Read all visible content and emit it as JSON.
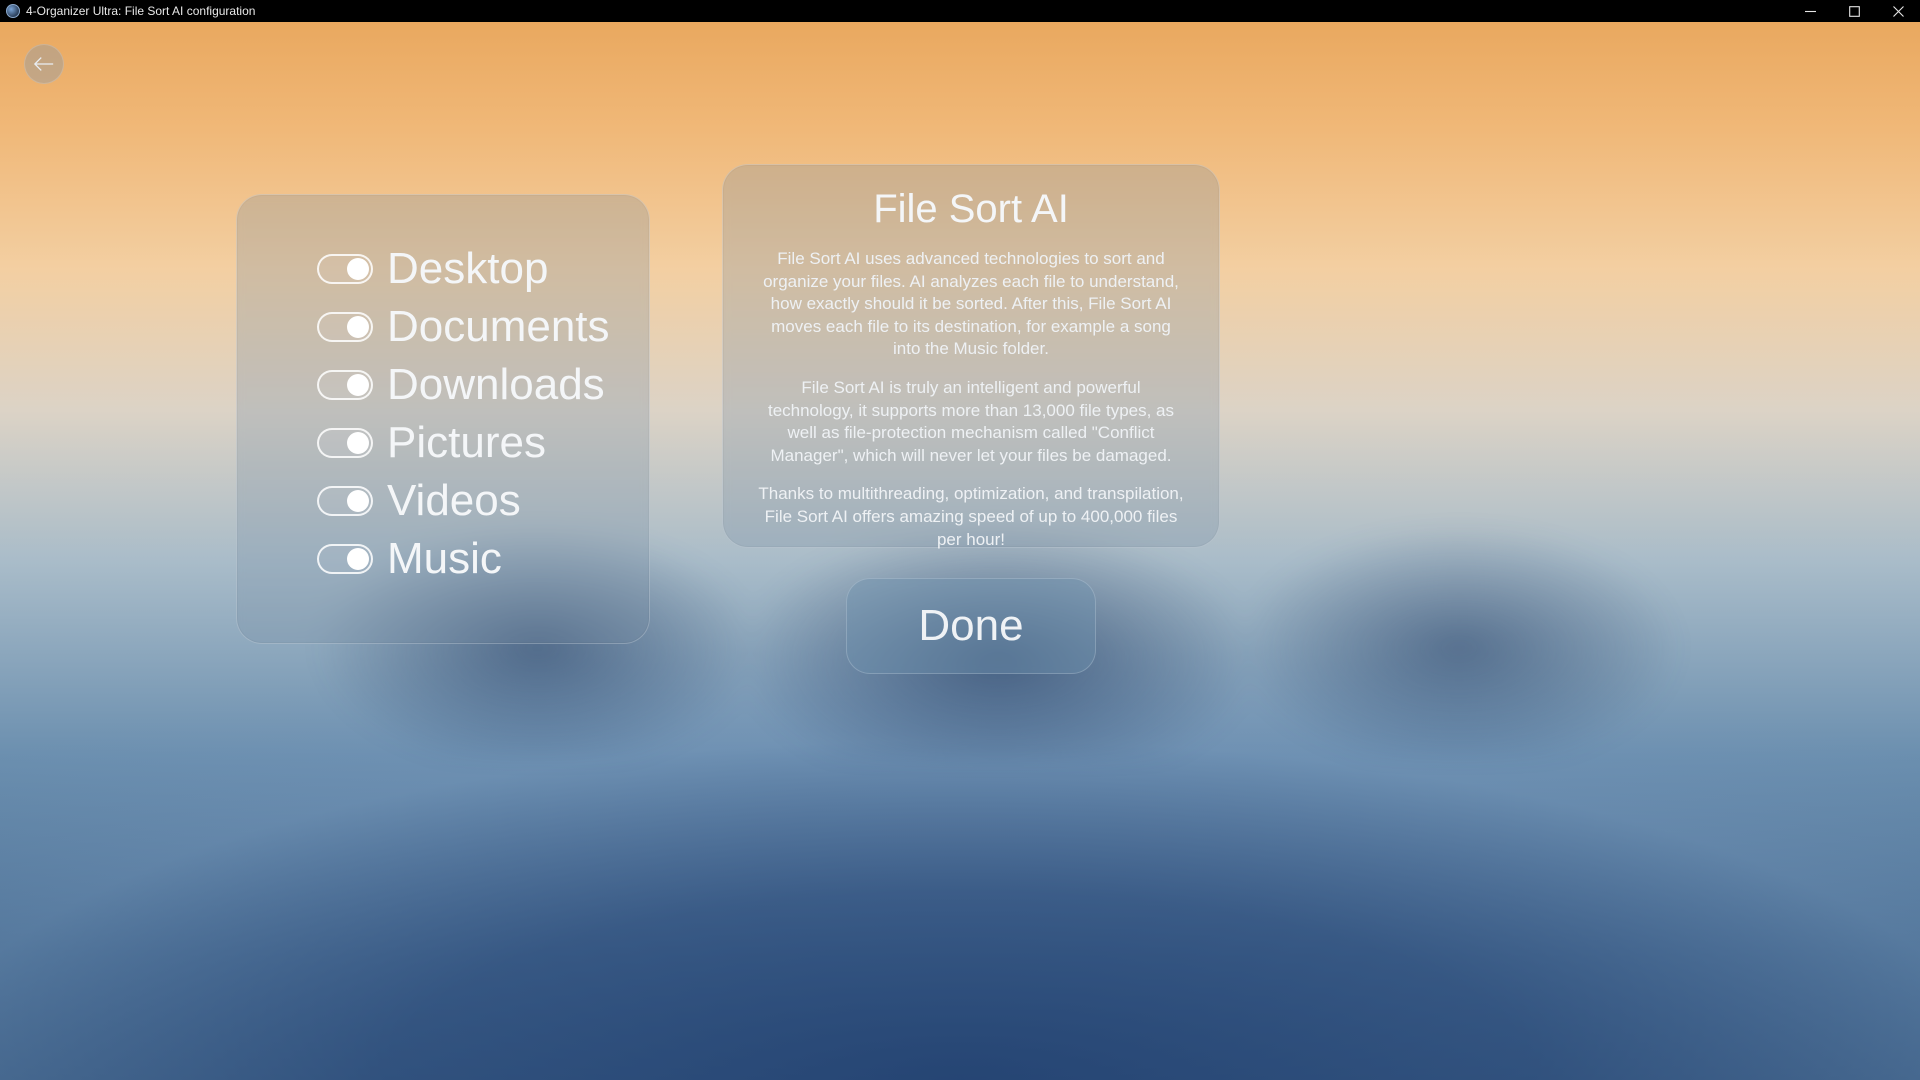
{
  "window": {
    "title": "4-Organizer Ultra: File Sort AI configuration"
  },
  "toggles": {
    "items": [
      {
        "label": "Desktop",
        "on": true
      },
      {
        "label": "Documents",
        "on": true
      },
      {
        "label": "Downloads",
        "on": true
      },
      {
        "label": "Pictures",
        "on": true
      },
      {
        "label": "Videos",
        "on": true
      },
      {
        "label": "Music",
        "on": true
      }
    ]
  },
  "info": {
    "title": "File Sort AI",
    "para1": "File Sort AI uses advanced technologies to sort and organize your files. AI analyzes each file to understand, how exactly should it be sorted. After this, File Sort AI moves each file to its destination, for example a song into the Music folder.",
    "para2": "File Sort AI is truly an intelligent and powerful technology, it supports more than 13,000 file types, as well as file-protection mechanism called \"Conflict Manager\", which will never let your files be damaged.",
    "para3": "Thanks to multithreading, optimization, and transpilation, File Sort AI offers amazing speed of up to 400,000 files per hour!"
  },
  "buttons": {
    "done": "Done"
  }
}
